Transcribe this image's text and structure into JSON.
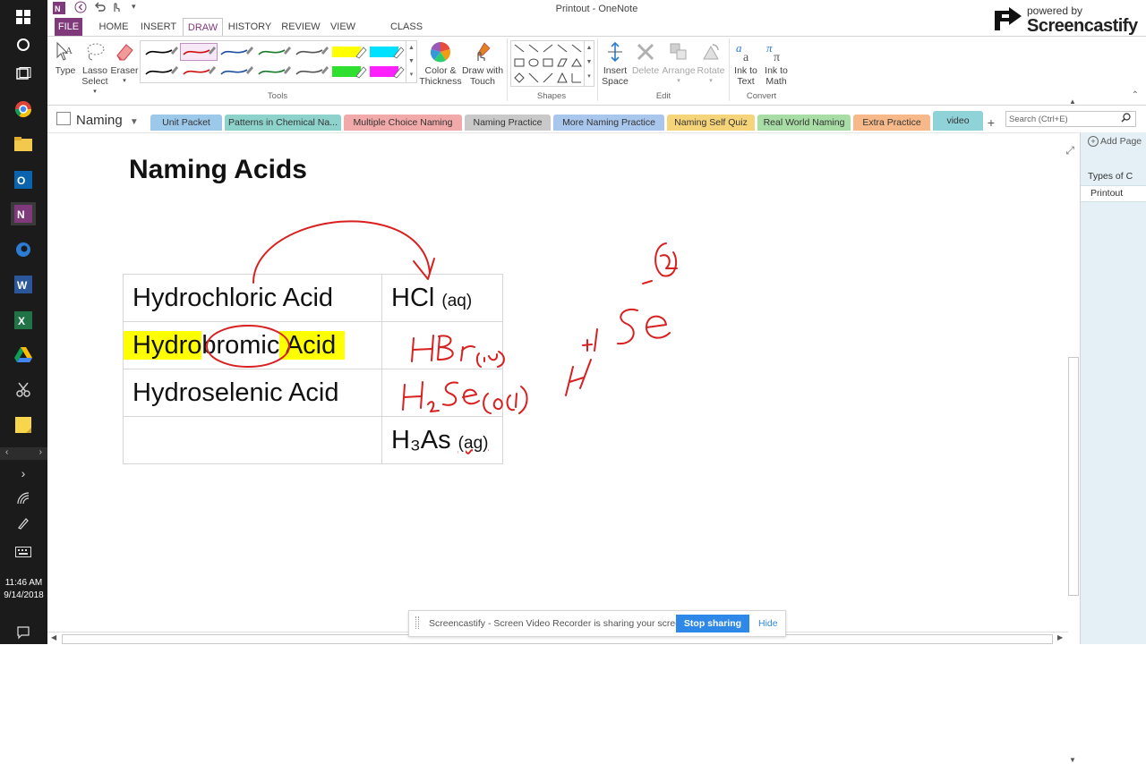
{
  "window": {
    "title": "Printout - OneNote"
  },
  "watermark": {
    "line1": "powered by",
    "line2": "Screencastify"
  },
  "ribbon_tabs": [
    "FILE",
    "HOME",
    "INSERT",
    "DRAW",
    "HISTORY",
    "REVIEW",
    "VIEW",
    "CLASS NOTEBOOK"
  ],
  "active_tab": "DRAW",
  "ribbon": {
    "type": "Type",
    "lasso": [
      "Lasso",
      "Select"
    ],
    "eraser": "Eraser",
    "color_thickness": [
      "Color &",
      "Thickness"
    ],
    "draw_touch": [
      "Draw with",
      "Touch"
    ],
    "insert_space": [
      "Insert",
      "Space"
    ],
    "delete": "Delete",
    "arrange": "Arrange",
    "rotate": "Rotate",
    "ink_to_text": [
      "Ink to",
      "Text"
    ],
    "ink_to_math": [
      "Ink to",
      "Math"
    ],
    "groups": {
      "tools": "Tools",
      "shapes": "Shapes",
      "edit": "Edit",
      "convert": "Convert"
    }
  },
  "pens": [
    {
      "color": "#000000"
    },
    {
      "color": "#d01010"
    },
    {
      "color": "#1f4fa0"
    },
    {
      "color": "#1a7a2a"
    },
    {
      "color": "#555555"
    },
    {
      "color": "#ffff00",
      "highlighter": true
    },
    {
      "color": "#00e0ff",
      "highlighter": true
    },
    {
      "color": "#000000"
    },
    {
      "color": "#d01010"
    },
    {
      "color": "#1f4fa0"
    },
    {
      "color": "#1a7a2a"
    },
    {
      "color": "#555555"
    },
    {
      "color": "#30e030",
      "highlighter": true
    },
    {
      "color": "#ff20ff",
      "highlighter": true
    }
  ],
  "notebook": {
    "name": "Naming"
  },
  "section_tabs": [
    {
      "label": "Unit Packet",
      "color": "#9cc8ea"
    },
    {
      "label": "Patterns in Chemical Na...",
      "color": "#8dd3cc"
    },
    {
      "label": "Multiple Choice Naming",
      "color": "#f2a9a9"
    },
    {
      "label": "Naming Practice",
      "color": "#c9c9c9"
    },
    {
      "label": "More Naming Practice",
      "color": "#a9c6ec"
    },
    {
      "label": "Naming Self Quiz",
      "color": "#f6d47a"
    },
    {
      "label": "Real World Naming",
      "color": "#a8dda5"
    },
    {
      "label": "Extra Practice",
      "color": "#f7b98a"
    },
    {
      "label": "video",
      "color": "#8fd3d8"
    }
  ],
  "search": {
    "placeholder": "Search (Ctrl+E)"
  },
  "page": {
    "title": "Naming Acids",
    "rows": [
      {
        "name": "Hydrochloric Acid",
        "formula": "HCl",
        "state": "(aq)"
      },
      {
        "name_pre": "Hydro",
        "name_mid": "bromic",
        "name_post": " Acid",
        "formula": "",
        "state": ""
      },
      {
        "name": "Hydroselenic Acid",
        "formula": "",
        "state": ""
      },
      {
        "name": "",
        "formula": "H₃As",
        "state": "(ag)"
      }
    ]
  },
  "page_list": {
    "add_page": "Add Page",
    "items": [
      "Types of C",
      "Printout"
    ]
  },
  "taskbar": {
    "time": "11:46 AM",
    "date": "9/14/2018"
  },
  "share_bar": {
    "message": "Screencastify - Screen Video Recorder is sharing your screen.",
    "stop": "Stop sharing",
    "hide": "Hide"
  }
}
